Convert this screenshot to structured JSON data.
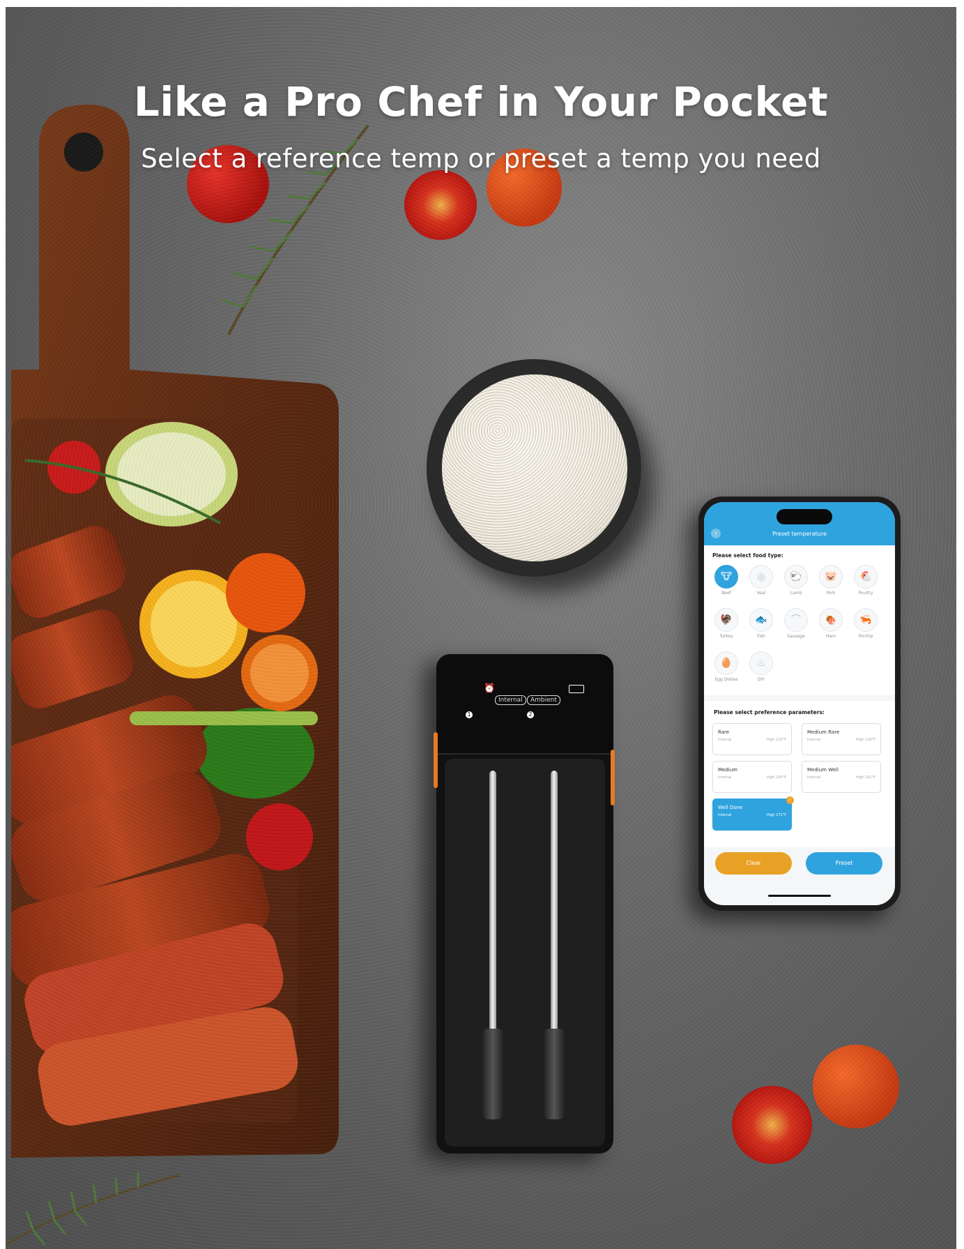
{
  "headline": "Like a Pro Chef in Your Pocket",
  "subheadline": "Select a reference temp or preset a temp you need",
  "device": {
    "label_internal": "Internal",
    "label_ambient": "Ambient",
    "probe_1": "1",
    "probe_2": "2"
  },
  "phone": {
    "title": "Preset temperature",
    "food_prompt": "Please select food type:",
    "foods": [
      {
        "name": "Beef",
        "icon": "cow-icon",
        "glyph": "🐮",
        "selected": true
      },
      {
        "name": "Veal",
        "icon": "veal-icon",
        "glyph": "◎",
        "selected": false
      },
      {
        "name": "Lamb",
        "icon": "sheep-icon",
        "glyph": "🐑",
        "selected": false
      },
      {
        "name": "Pork",
        "icon": "pig-icon",
        "glyph": "🐷",
        "selected": false
      },
      {
        "name": "Poultry",
        "icon": "chicken-icon",
        "glyph": "🐔",
        "selected": false
      },
      {
        "name": "Turkey",
        "icon": "turkey-icon",
        "glyph": "🦃",
        "selected": false
      },
      {
        "name": "Fish",
        "icon": "fish-icon",
        "glyph": "🐟",
        "selected": false
      },
      {
        "name": "Sausage",
        "icon": "sausage-icon",
        "glyph": "⌒",
        "selected": false
      },
      {
        "name": "Ham",
        "icon": "ham-icon",
        "glyph": "🍖",
        "selected": false
      },
      {
        "name": "Shrimp",
        "icon": "shrimp-icon",
        "glyph": "🦐",
        "selected": false
      },
      {
        "name": "Egg Dishes",
        "icon": "egg-icon",
        "glyph": "🥚",
        "selected": false
      },
      {
        "name": "DIY",
        "icon": "grill-icon",
        "glyph": "♨",
        "selected": false
      }
    ],
    "pref_prompt": "Please select preference parameters:",
    "preferences": [
      {
        "name": "Rare",
        "type": "Internal",
        "temp": "High 120°F",
        "selected": false
      },
      {
        "name": "Medium Rare",
        "type": "Internal",
        "temp": "High 129°F",
        "selected": false
      },
      {
        "name": "Medium",
        "type": "Internal",
        "temp": "High 140°F",
        "selected": false
      },
      {
        "name": "Medium Well",
        "type": "Internal",
        "temp": "High 151°F",
        "selected": false
      },
      {
        "name": "Well Done",
        "type": "Internal",
        "temp": "High 171°F",
        "selected": true
      }
    ],
    "clear_label": "Clear",
    "preset_label": "Preset"
  },
  "colors": {
    "accent_blue": "#2fa3de",
    "clear_orange": "#e9a125",
    "background_gray": "#6e6e6e"
  }
}
